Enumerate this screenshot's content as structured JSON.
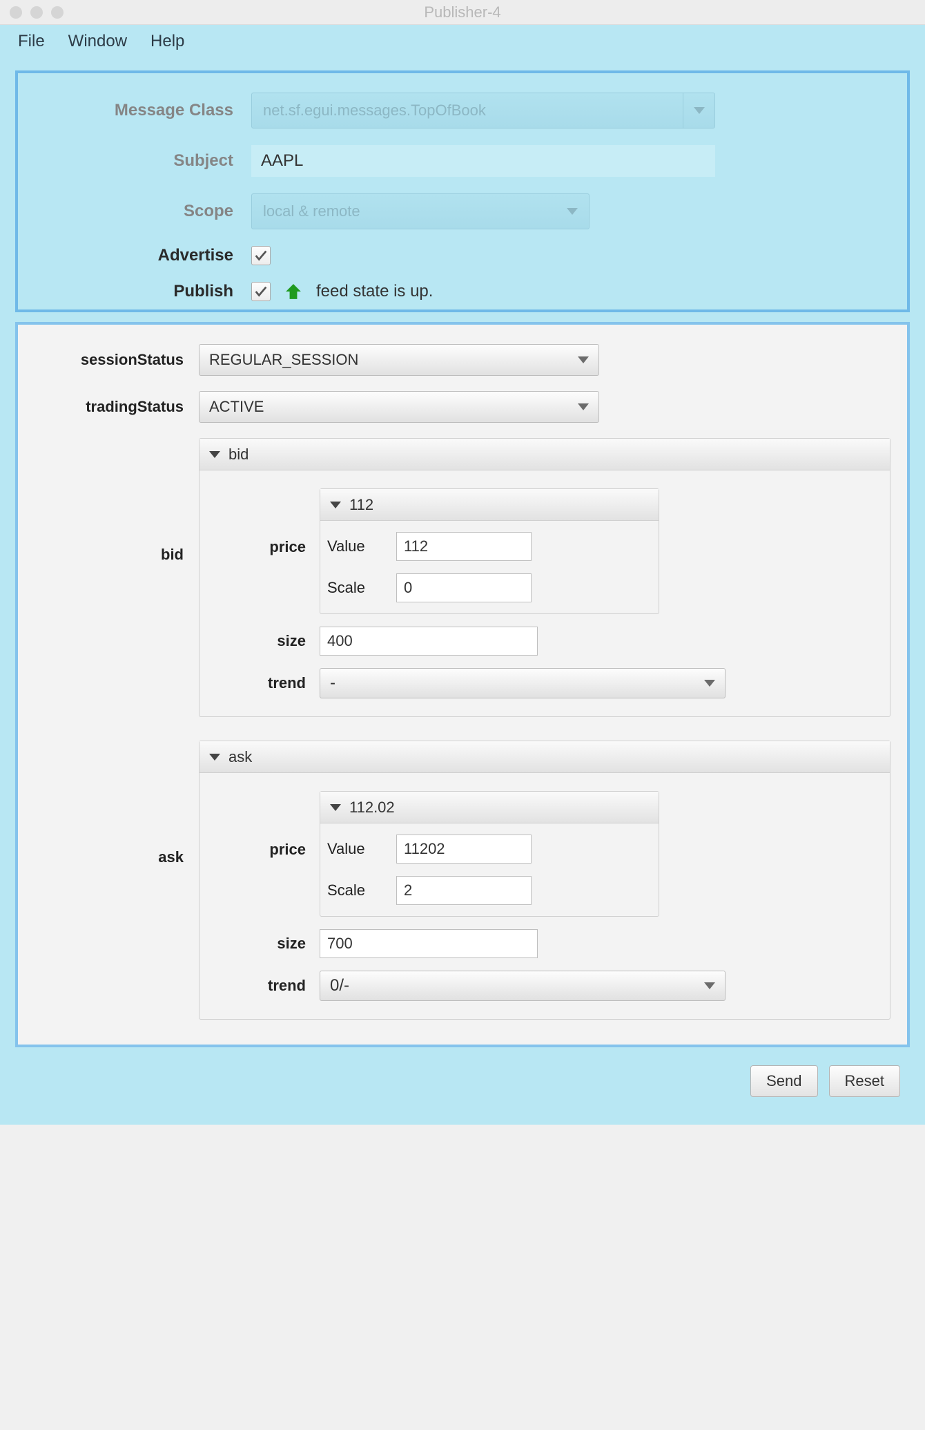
{
  "window": {
    "title": "Publisher-4"
  },
  "menu": {
    "file": "File",
    "window": "Window",
    "help": "Help"
  },
  "upper": {
    "messageClassLabel": "Message Class",
    "messageClassValue": "net.sf.egui.messages.TopOfBook",
    "subjectLabel": "Subject",
    "subjectValue": "AAPL",
    "scopeLabel": "Scope",
    "scopeValue": "local & remote",
    "advertiseLabel": "Advertise",
    "advertiseChecked": true,
    "publishLabel": "Publish",
    "publishChecked": true,
    "feedStateText": "feed state is up."
  },
  "lower": {
    "sessionStatusLabel": "sessionStatus",
    "sessionStatusValue": "REGULAR_SESSION",
    "tradingStatusLabel": "tradingStatus",
    "tradingStatusValue": "ACTIVE",
    "bid": {
      "sideLabel": "bid",
      "headerLabel": "bid",
      "priceLabel": "price",
      "priceHeader": "112",
      "valueLabel": "Value",
      "valueValue": "112",
      "scaleLabel": "Scale",
      "scaleValue": "0",
      "sizeLabel": "size",
      "sizeValue": "400",
      "trendLabel": "trend",
      "trendValue": "-"
    },
    "ask": {
      "sideLabel": "ask",
      "headerLabel": "ask",
      "priceLabel": "price",
      "priceHeader": "112.02",
      "valueLabel": "Value",
      "valueValue": "11202",
      "scaleLabel": "Scale",
      "scaleValue": "2",
      "sizeLabel": "size",
      "sizeValue": "700",
      "trendLabel": "trend",
      "trendValue": "0/-"
    }
  },
  "buttons": {
    "send": "Send",
    "reset": "Reset"
  }
}
